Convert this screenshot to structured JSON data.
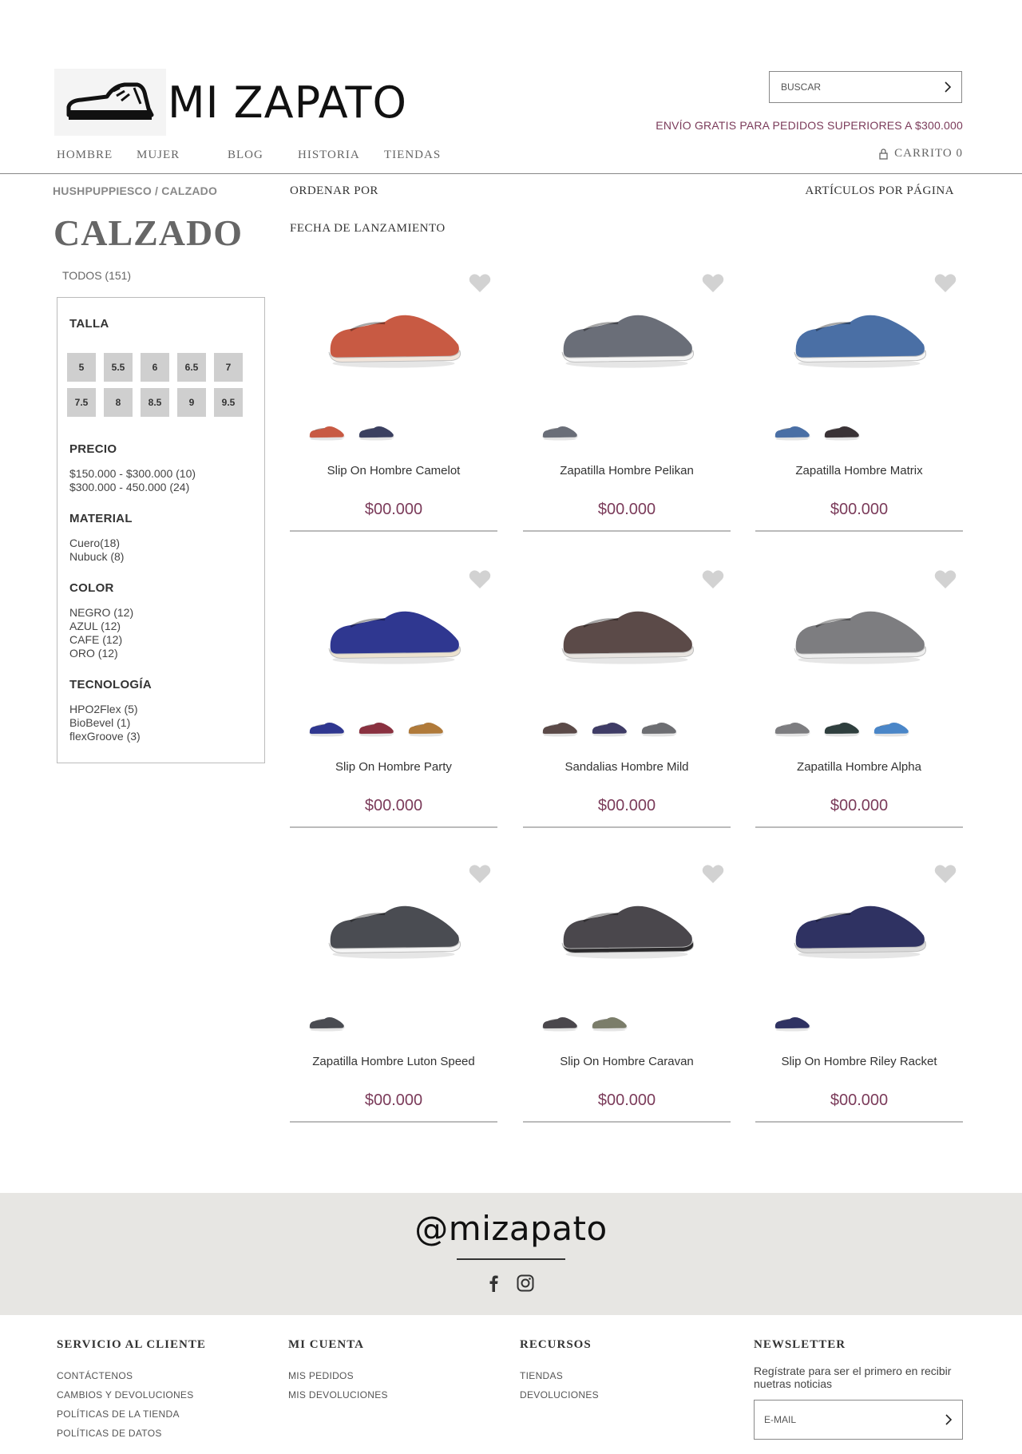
{
  "brand": {
    "name": "MI ZAPATO",
    "logo_icon": "shoe-icon"
  },
  "search": {
    "placeholder": "BUSCAR"
  },
  "promo": {
    "free_shipping": "ENVÍO GRATIS PARA PEDIDOS SUPERIORES A $300.000"
  },
  "nav": {
    "hombre": "HOMBRE",
    "mujer": "MUJER",
    "blog": "BLOG",
    "historia": "HISTORIA",
    "tiendas": "TIENDAS"
  },
  "cart": {
    "label": "CARRITO 0"
  },
  "breadcrumb": "HUSHPUPPIESCO / CALZADO",
  "page_title": "CALZADO",
  "todos": "TODOS (151)",
  "sort": {
    "label": "ORDENAR POR",
    "value": "FECHA DE LANZAMIENTO",
    "per_page": "ARTÍCULOS POR PÁGINA"
  },
  "filters": {
    "talla": {
      "heading": "TALLA",
      "sizes": [
        "5",
        "5.5",
        "6",
        "6.5",
        "7",
        "7.5",
        "8",
        "8.5",
        "9",
        "9.5"
      ]
    },
    "precio": {
      "heading": "PRECIO",
      "options": [
        "$150.000 - $300.000 (10)",
        "$300.000 - 450.000 (24)"
      ]
    },
    "material": {
      "heading": "MATERIAL",
      "options": [
        "Cuero(18)",
        "Nubuck (8)"
      ]
    },
    "color": {
      "heading": "COLOR",
      "options": [
        "NEGRO (12)",
        "AZUL (12)",
        "CAFE (12)",
        "ORO (12)"
      ]
    },
    "tecnologia": {
      "heading": "TECNOLOGÍA",
      "options": [
        "HPO2Flex (5)",
        "BioBevel (1)",
        "flexGroove (3)"
      ]
    }
  },
  "products": [
    {
      "name": "Slip On Hombre Camelot",
      "price": "$00.000",
      "color": "#c85a43",
      "sole": "#f2e6dc",
      "swatches": [
        "#c85a43",
        "#3b4060"
      ]
    },
    {
      "name": "Zapatilla Hombre Pelikan",
      "price": "$00.000",
      "color": "#6a6e78",
      "sole": "#f5f5f5",
      "swatches": [
        "#6a6e78"
      ]
    },
    {
      "name": "Zapatilla Hombre Matrix",
      "price": "$00.000",
      "color": "#4a6fa5",
      "sole": "#f5f5f5",
      "swatches": [
        "#4a6fa5",
        "#3a3336"
      ]
    },
    {
      "name": "Slip On Hombre Party",
      "price": "$00.000",
      "color": "#2f3790",
      "sole": "#ece2cf",
      "swatches": [
        "#2f3790",
        "#8a3140",
        "#b07a3a"
      ]
    },
    {
      "name": "Sandalias Hombre Mild",
      "price": "$00.000",
      "color": "#5b4a48",
      "sole": "#e8e4e0",
      "swatches": [
        "#5b4a48",
        "#3f3c66",
        "#6d6e72"
      ]
    },
    {
      "name": "Zapatilla Hombre Alpha",
      "price": "$00.000",
      "color": "#7d7d80",
      "sole": "#eeeeee",
      "swatches": [
        "#7d7d80",
        "#2f3f3e",
        "#4a86c8"
      ]
    },
    {
      "name": "Zapatilla Hombre Luton Speed",
      "price": "$00.000",
      "color": "#4a4c52",
      "sole": "#f5f5f5",
      "swatches": [
        "#4a4c52"
      ]
    },
    {
      "name": "Slip On Hombre Caravan",
      "price": "$00.000",
      "color": "#4a474c",
      "sole": "#2b2a2c",
      "swatches": [
        "#4a474c",
        "#7b7d6a"
      ]
    },
    {
      "name": "Slip On Hombre Riley Racket",
      "price": "$00.000",
      "color": "#2f3262",
      "sole": "#d9d9d9",
      "swatches": [
        "#2f3262"
      ]
    }
  ],
  "social": {
    "handle": "@mizapato",
    "icons": [
      "facebook-icon",
      "instagram-icon"
    ]
  },
  "footer": {
    "servicio": {
      "heading": "SERVICIO AL CLIENTE",
      "links": [
        "CONTÁCTENOS",
        "CAMBIOS Y DEVOLUCIONES",
        "POLÍTICAS DE LA TIENDA",
        "POLÍTICAS DE DATOS"
      ]
    },
    "cuenta": {
      "heading": "MI CUENTA",
      "links": [
        "MIS PEDIDOS",
        "MIS DEVOLUCIONES"
      ]
    },
    "recursos": {
      "heading": "RECURSOS",
      "links": [
        "TIENDAS",
        "DEVOLUCIONES"
      ]
    },
    "newsletter": {
      "heading": "NEWSLETTER",
      "text": "Regístrate para ser el primero en recibir nuetras noticias",
      "placeholder": "E-MAIL"
    }
  },
  "colors": {
    "accent": "#7b3b5a",
    "chip": "#cfcfcf",
    "band": "#e7e6e3"
  }
}
